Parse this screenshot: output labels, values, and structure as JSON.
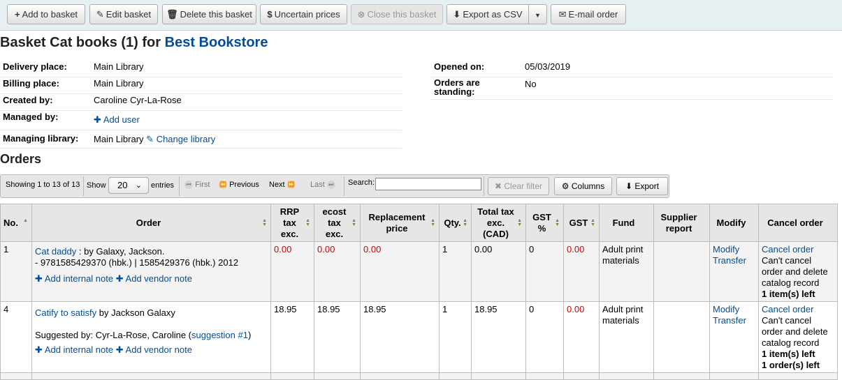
{
  "toolbar": {
    "add_to_basket": "Add to basket",
    "edit_basket": "Edit basket",
    "delete_basket": "Delete this basket",
    "uncertain_prices": "Uncertain prices",
    "close_basket": "Close this basket",
    "export_csv": "Export as CSV",
    "email_order": "E-mail order"
  },
  "header": {
    "title_prefix": "Basket Cat books (1) for",
    "vendor": "Best Bookstore"
  },
  "basket_details": {
    "delivery_label": "Delivery place:",
    "delivery_value": "Main Library",
    "billing_label": "Billing place:",
    "billing_value": "Main Library",
    "created_label": "Created by:",
    "created_value": "Caroline Cyr-La-Rose",
    "managed_label": "Managed by:",
    "add_user": "Add user",
    "managing_lib_label": "Managing library:",
    "managing_lib_value": "Main Library",
    "change_library": "Change library",
    "opened_label": "Opened on:",
    "opened_value": "05/03/2019",
    "standing_label_1": "Orders are",
    "standing_label_2": "standing:",
    "standing_value": "No"
  },
  "orders_heading": "Orders",
  "datatable": {
    "info": "Showing 1 to 13 of 13",
    "show": "Show",
    "page_size": "20",
    "entries": "entries",
    "first": "First",
    "previous": "Previous",
    "next": "Next",
    "last": "Last",
    "search_label": "Search:",
    "search_value": "",
    "clear_filter": "Clear filter",
    "columns": "Columns",
    "export": "Export"
  },
  "table": {
    "headers": {
      "no": "No.",
      "order": "Order",
      "rrp_1": "RRP",
      "rrp_2": "tax",
      "rrp_3": "exc.",
      "ecost_1": "ecost",
      "ecost_2": "tax",
      "ecost_3": "exc.",
      "replacement_1": "Replacement",
      "replacement_2": "price",
      "qty": "Qty.",
      "total_1": "Total tax",
      "total_2": "exc.",
      "total_3": "(CAD)",
      "gst_pct_1": "GST",
      "gst_pct_2": "%",
      "gst": "GST",
      "fund": "Fund",
      "supplier_1": "Supplier",
      "supplier_2": "report",
      "modify": "Modify",
      "cancel": "Cancel order"
    },
    "rows": [
      {
        "no": "1",
        "title": "Cat daddy",
        "sep": " : ",
        "author": "by Galaxy, Jackson.",
        "isbn": "- 9781585429370 (hbk.) | 1585429376 (hbk.) 2012",
        "add_internal": "Add internal note",
        "add_vendor": "Add vendor note",
        "rrp": "0.00",
        "ecost": "0.00",
        "replacement": "0.00",
        "qty": "1",
        "total": "0.00",
        "gst_pct": "0",
        "gst": "0.00",
        "fund_1": "Adult print",
        "fund_2": "materials",
        "modify": "Modify",
        "transfer": "Transfer",
        "cancel": "Cancel order",
        "cancel_note_1": "Can't cancel",
        "cancel_note_2": "order and delete",
        "cancel_note_3": "catalog record",
        "items_left": "1 item(s) left"
      },
      {
        "no": "4",
        "title": "Catify to satisfy",
        "author": "by Jackson Galaxy",
        "suggested_prefix": "Suggested by: Cyr-La-Rose, Caroline (",
        "suggestion_link": "suggestion #1",
        "suggested_suffix": ")",
        "add_internal": "Add internal note",
        "add_vendor": "Add vendor note",
        "rrp": "18.95",
        "ecost": "18.95",
        "replacement": "18.95",
        "qty": "1",
        "total": "18.95",
        "gst_pct": "0",
        "gst": "0.00",
        "fund_1": "Adult print",
        "fund_2": "materials",
        "modify": "Modify",
        "transfer": "Transfer",
        "cancel": "Cancel order",
        "cancel_note_1": "Can't cancel",
        "cancel_note_2": "order and delete",
        "cancel_note_3": "catalog record",
        "items_left": "1 item(s) left",
        "orders_left": "1 order(s) left"
      }
    ]
  }
}
